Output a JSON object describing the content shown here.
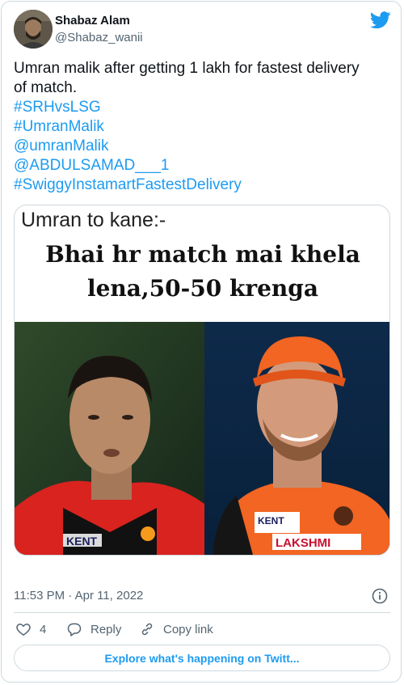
{
  "author": {
    "name": "Shabaz Alam",
    "handle": "@Shabaz_wanii"
  },
  "tweet": {
    "text_line1": "Umran malik after getting 1 lakh for fastest delivery",
    "text_line2": "of match.",
    "hashtag1": "#SRHvsLSG",
    "hashtag2": "#UmranMalik",
    "mention1": "@umranMalik",
    "mention2": "@ABDULSAMAD___1",
    "hashtag3": "#SwiggyInstamartFastestDelivery"
  },
  "media": {
    "meme_top_text": "Umran to kane:-",
    "meme_caption_line1": "Bhai hr match mai khela",
    "meme_caption_line2": "lena,50-50 krenga",
    "jersey_text_left": "KENT",
    "jersey_text_right_1": "KENT",
    "jersey_text_right_2": "LAKSHMI"
  },
  "meta": {
    "timestamp": "11:53 PM · Apr 11, 2022"
  },
  "actions": {
    "like_count": "4",
    "reply_label": "Reply",
    "copy_link_label": "Copy link"
  },
  "explore_button": {
    "label": "Explore what's happening on Twitt..."
  },
  "colors": {
    "accent": "#1d9bf0",
    "text": "#0f1419",
    "secondary": "#536471",
    "border": "#cfd9de",
    "srh_orange": "#f26522"
  },
  "icons": [
    "twitter-bird-icon",
    "info-icon",
    "heart-icon",
    "reply-icon",
    "link-icon"
  ]
}
